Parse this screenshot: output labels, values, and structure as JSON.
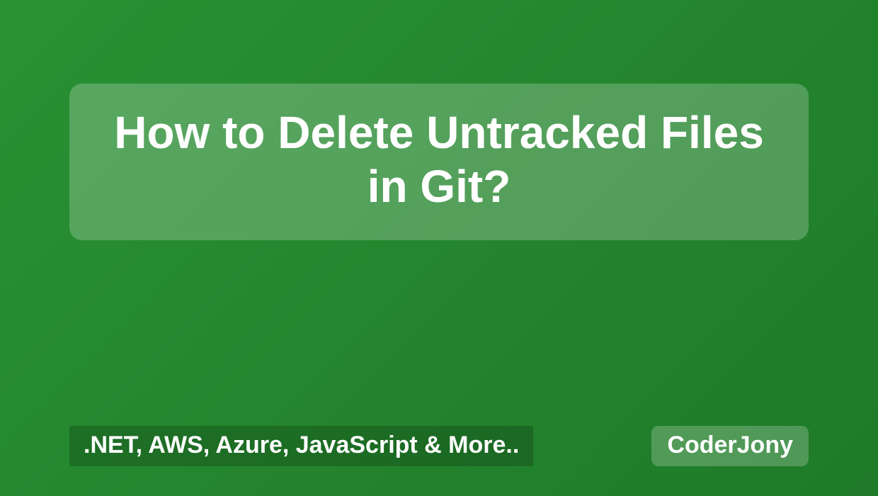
{
  "title": "How to Delete Untracked Files in Git?",
  "tags": ".NET, AWS, Azure, JavaScript & More..",
  "brand": "CoderJony"
}
